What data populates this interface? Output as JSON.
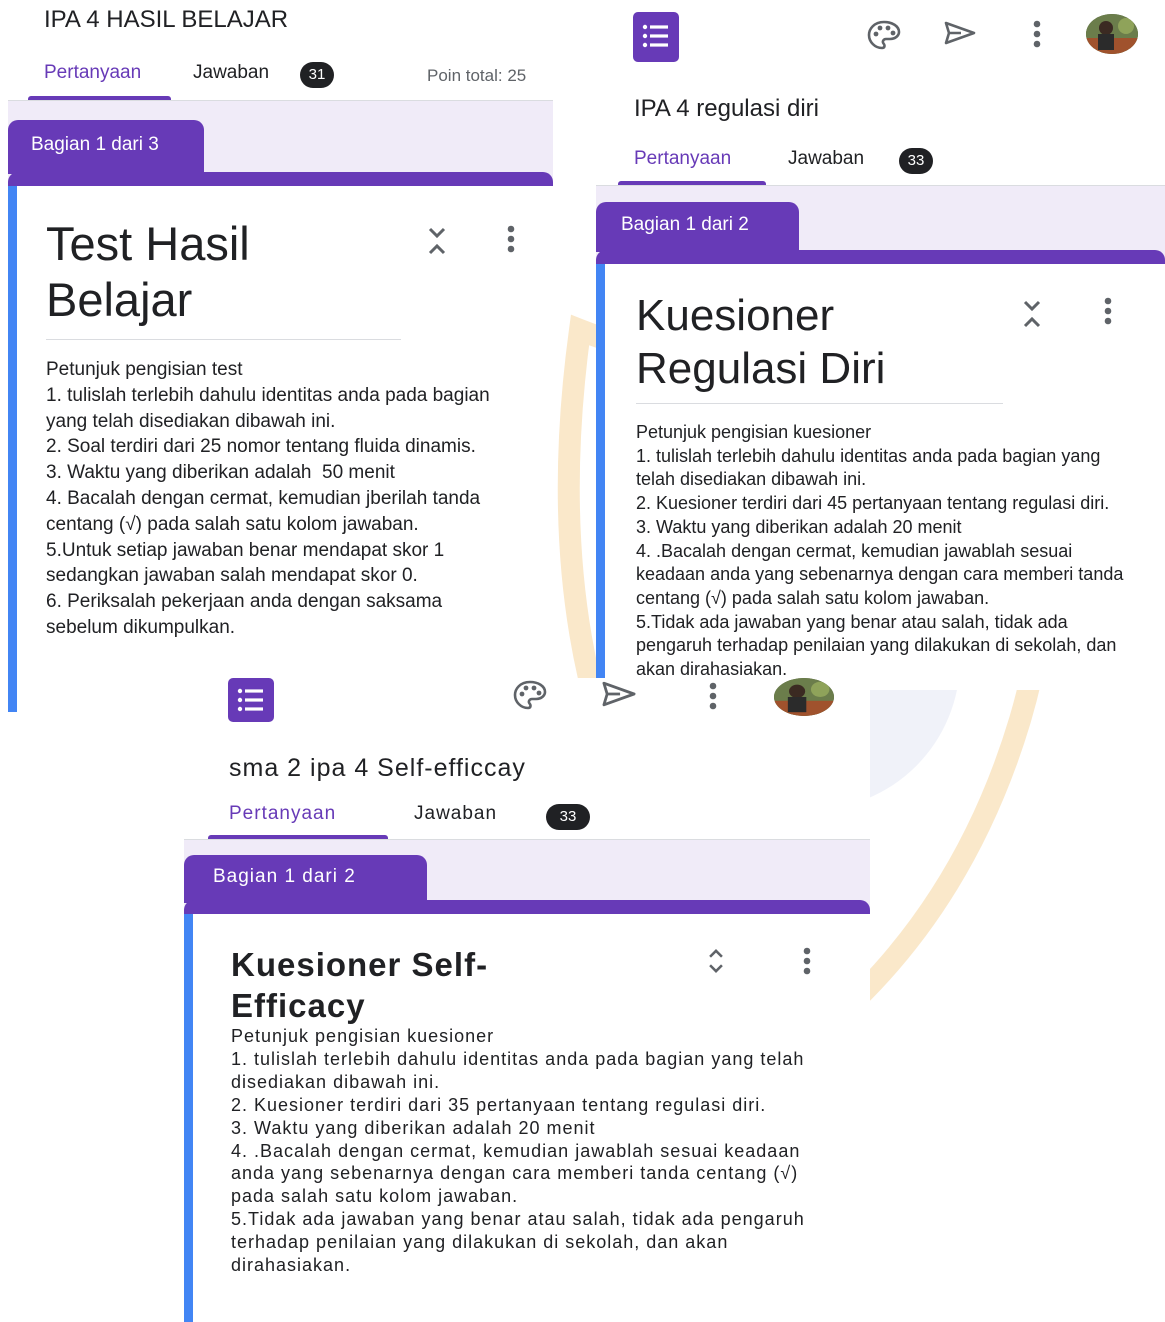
{
  "panels": [
    {
      "form_title": "IPA 4 HASIL BELAJAR",
      "tabs": {
        "questions": "Pertanyaan",
        "responses": "Jawaban",
        "responses_count": "31"
      },
      "points_total": "Poin total: 25",
      "section_label": "Bagian 1 dari 3",
      "card_title": "Test Hasil Belajar",
      "description": "Petunjuk pengisian test\n1. tulislah terlebih dahulu identitas anda pada bagian yang telah disediakan dibawah ini.\n2. Soal terdiri dari 25 nomor tentang fluida dinamis.\n3. Waktu yang diberikan adalah  50 menit\n4. Bacalah dengan cermat, kemudian jberilah tanda centang (√) pada salah satu kolom jawaban.\n5.Untuk setiap jawaban benar mendapat skor 1 sedangkan jawaban salah mendapat skor 0.\n6. Periksalah pekerjaan anda dengan saksama sebelum dikumpulkan."
    },
    {
      "form_title": "IPA 4 regulasi diri",
      "tabs": {
        "questions": "Pertanyaan",
        "responses": "Jawaban",
        "responses_count": "33"
      },
      "section_label": "Bagian 1 dari 2",
      "card_title": "Kuesioner Regulasi Diri",
      "description": "Petunjuk pengisian kuesioner\n1. tulislah terlebih dahulu identitas anda pada bagian yang telah disediakan dibawah ini.\n2. Kuesioner terdiri dari 45 pertanyaan tentang regulasi diri.\n3. Waktu yang diberikan adalah 20 menit\n4. .Bacalah dengan cermat, kemudian jawablah sesuai keadaan anda yang sebenarnya dengan cara memberi tanda centang (√) pada salah satu kolom jawaban.\n5.Tidak ada jawaban yang benar atau salah, tidak ada pengaruh terhadap penilaian yang dilakukan di sekolah, dan akan dirahasiakan."
    },
    {
      "form_title": "sma 2 ipa 4 Self-efficcay",
      "tabs": {
        "questions": "Pertanyaan",
        "responses": "Jawaban",
        "responses_count": "33"
      },
      "section_label": "Bagian 1 dari 2",
      "card_title": "Kuesioner Self-Efficacy",
      "description": "Petunjuk pengisian kuesioner\n1. tulislah terlebih dahulu identitas anda pada bagian yang telah disediakan dibawah ini.\n2. Kuesioner terdiri dari 35 pertanyaan tentang regulasi diri.\n3. Waktu yang diberikan adalah 20 menit\n4. .Bacalah dengan cermat, kemudian jawablah sesuai keadaan anda yang sebenarnya dengan cara memberi tanda centang (√) pada salah satu kolom jawaban.\n5.Tidak ada jawaban yang benar atau salah, tidak ada pengaruh terhadap penilaian yang dilakukan di sekolah, dan akan dirahasiakan."
    }
  ],
  "icons": [
    "forms-app-icon",
    "palette-icon",
    "send-icon",
    "more-vert-icon",
    "avatar",
    "collapse-icon"
  ],
  "colors": {
    "accent": "#673ab7",
    "card_border": "#4285f4",
    "section_bg": "#f0ebf8"
  }
}
